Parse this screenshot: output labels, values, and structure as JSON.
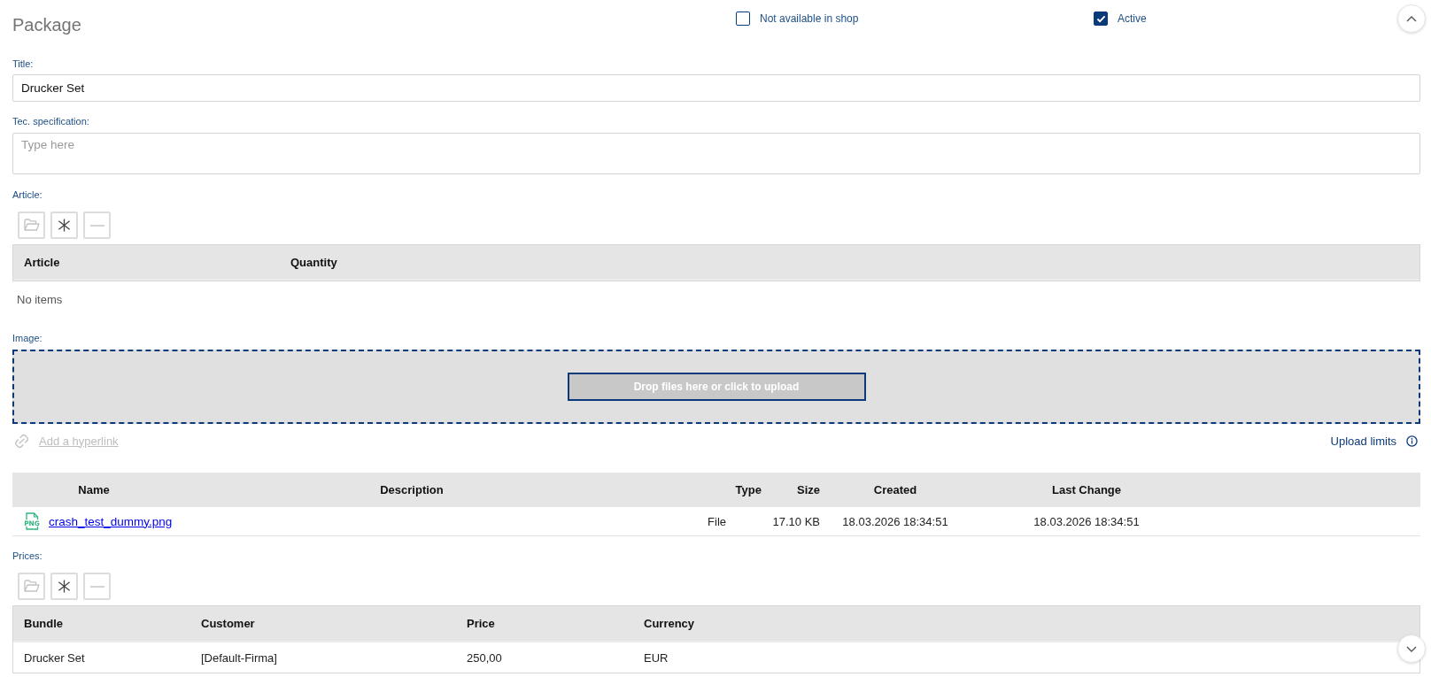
{
  "header": {
    "title": "Package",
    "checkboxes": [
      {
        "label": "Not available in shop",
        "checked": false
      },
      {
        "label": "Active",
        "checked": true
      }
    ]
  },
  "fields": [
    {
      "kind": "input",
      "label": "Title:",
      "value": "Drucker Set"
    },
    {
      "kind": "textarea",
      "label": "Tec. specification:",
      "placeholder": "Type here"
    }
  ],
  "article": {
    "label": "Article:",
    "toolbar": [
      {
        "kind": "open",
        "disabled": true
      },
      {
        "kind": "add",
        "disabled": false
      },
      {
        "kind": "remove",
        "disabled": true
      }
    ],
    "table": {
      "columns": [
        "Article",
        "Quantity"
      ],
      "empty_text": "No items"
    }
  },
  "image": {
    "label": "Image:",
    "dropzone_button": "Drop files here or click to upload",
    "hyperlink": {
      "label": "Add a hyperlink",
      "disabled": true
    },
    "upload_limits": "Upload limits",
    "files": {
      "columns": [
        "Name",
        "Description",
        "Type",
        "Size",
        "Created",
        "Last Change"
      ],
      "rows": [
        {
          "file_badge": "PNG",
          "name": "crash_test_dummy.png",
          "type": "File",
          "size": "17.10 KB",
          "created": "18.03.2026 18:34:51",
          "last_change": "18.03.2026 18:34:51"
        }
      ]
    }
  },
  "prices": {
    "label": "Prices:",
    "toolbar": [
      {
        "kind": "open",
        "disabled": true
      },
      {
        "kind": "add",
        "disabled": false
      },
      {
        "kind": "remove",
        "disabled": true
      }
    ],
    "table": {
      "columns": [
        "Bundle",
        "Customer",
        "Price",
        "Currency"
      ],
      "rows": [
        [
          "Drucker Set",
          "[Default-Firma]",
          "250,00",
          "EUR"
        ]
      ]
    }
  }
}
